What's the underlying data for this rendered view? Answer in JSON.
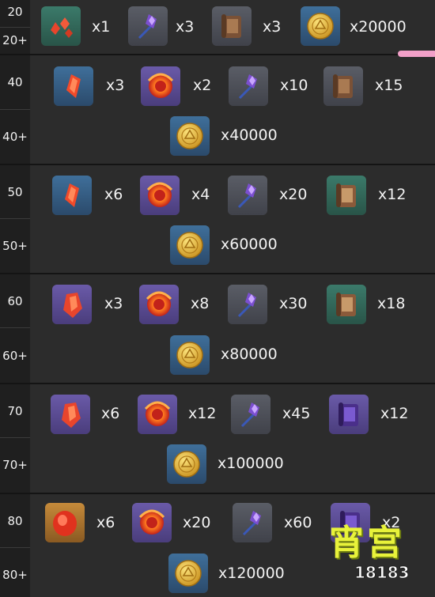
{
  "rows": [
    {
      "level": "20",
      "level_plus": "20+",
      "items": [
        {
          "icon": "red-crystal-shards-icon",
          "qty": "x1"
        },
        {
          "icon": "purple-flower-icon",
          "qty": "x3"
        },
        {
          "icon": "brown-scroll-icon",
          "qty": "x3"
        },
        {
          "icon": "gold-coin-icon",
          "qty": "x20000"
        }
      ]
    },
    {
      "level": "40",
      "level_plus": "40+",
      "items": [
        {
          "icon": "red-crystal-icon",
          "qty": "x3"
        },
        {
          "icon": "fire-orb-icon",
          "qty": "x2"
        },
        {
          "icon": "purple-flower-icon",
          "qty": "x10"
        },
        {
          "icon": "brown-scroll-icon",
          "qty": "x15"
        },
        {
          "icon": "gold-coin-icon",
          "qty": "x40000"
        }
      ]
    },
    {
      "level": "50",
      "level_plus": "50+",
      "items": [
        {
          "icon": "red-crystal-icon",
          "qty": "x6"
        },
        {
          "icon": "fire-orb-icon",
          "qty": "x4"
        },
        {
          "icon": "purple-flower-icon",
          "qty": "x20"
        },
        {
          "icon": "green-scroll-icon",
          "qty": "x12"
        },
        {
          "icon": "gold-coin-icon",
          "qty": "x60000"
        }
      ]
    },
    {
      "level": "60",
      "level_plus": "60+",
      "items": [
        {
          "icon": "red-crystal-large-icon",
          "qty": "x3"
        },
        {
          "icon": "fire-orb-icon",
          "qty": "x8"
        },
        {
          "icon": "purple-flower-icon",
          "qty": "x30"
        },
        {
          "icon": "green-scroll-icon",
          "qty": "x18"
        },
        {
          "icon": "gold-coin-icon",
          "qty": "x80000"
        }
      ]
    },
    {
      "level": "70",
      "level_plus": "70+",
      "items": [
        {
          "icon": "red-crystal-large-icon",
          "qty": "x6"
        },
        {
          "icon": "fire-orb-icon",
          "qty": "x12"
        },
        {
          "icon": "purple-flower-icon",
          "qty": "x45"
        },
        {
          "icon": "purple-scroll-icon",
          "qty": "x12"
        },
        {
          "icon": "gold-coin-icon",
          "qty": "x100000"
        }
      ]
    },
    {
      "level": "80",
      "level_plus": "80+",
      "items": [
        {
          "icon": "red-gem-icon",
          "qty": "x6"
        },
        {
          "icon": "fire-orb-icon",
          "qty": "x20"
        },
        {
          "icon": "purple-flower-icon",
          "qty": "x60"
        },
        {
          "icon": "purple-scroll-icon",
          "qty": "x2"
        },
        {
          "icon": "gold-coin-icon",
          "qty": "x120000"
        }
      ]
    }
  ],
  "watermark": {
    "text": "宵宫",
    "site": "18183"
  },
  "colors": {
    "accent": "#f2a0c8",
    "background": "#2c2c2c",
    "level_column": "#1f1f1f",
    "text": "#f2f2f2"
  }
}
